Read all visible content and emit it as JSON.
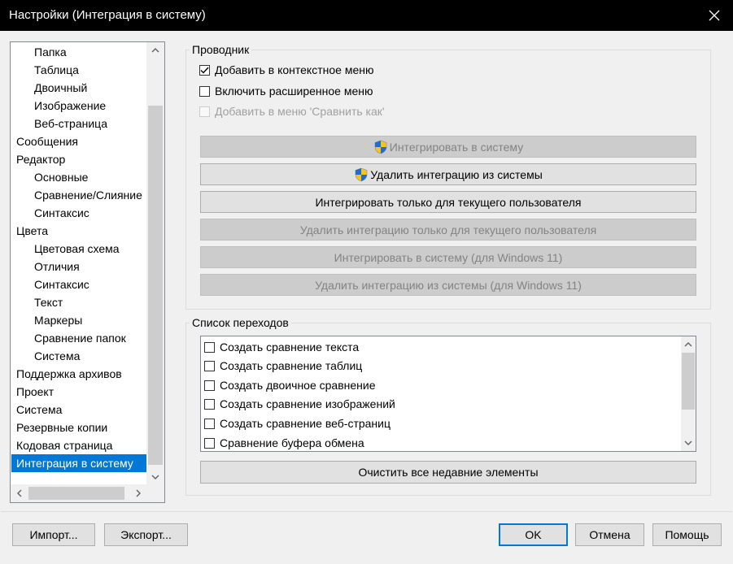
{
  "window": {
    "title": "Настройки (Интеграция в систему)"
  },
  "tree": {
    "items": [
      {
        "label": "Папка",
        "level": 1
      },
      {
        "label": "Таблица",
        "level": 1
      },
      {
        "label": "Двоичный",
        "level": 1
      },
      {
        "label": "Изображение",
        "level": 1
      },
      {
        "label": "Веб-страница",
        "level": 1
      },
      {
        "label": "Сообщения",
        "level": 0
      },
      {
        "label": "Редактор",
        "level": 0
      },
      {
        "label": "Основные",
        "level": 1
      },
      {
        "label": "Сравнение/Слияние",
        "level": 1
      },
      {
        "label": "Синтаксис",
        "level": 1
      },
      {
        "label": "Цвета",
        "level": 0
      },
      {
        "label": "Цветовая схема",
        "level": 1
      },
      {
        "label": "Отличия",
        "level": 1
      },
      {
        "label": "Синтаксис",
        "level": 1
      },
      {
        "label": "Текст",
        "level": 1
      },
      {
        "label": "Маркеры",
        "level": 1
      },
      {
        "label": "Сравнение папок",
        "level": 1
      },
      {
        "label": "Система",
        "level": 1
      },
      {
        "label": "Поддержка архивов",
        "level": 0
      },
      {
        "label": "Проект",
        "level": 0
      },
      {
        "label": "Система",
        "level": 0
      },
      {
        "label": "Резервные копии",
        "level": 0
      },
      {
        "label": "Кодовая страница",
        "level": 0
      },
      {
        "label": "Интеграция в систему",
        "level": 0,
        "selected": true
      }
    ]
  },
  "explorer": {
    "title": "Проводник",
    "options": [
      {
        "label": "Добавить в контекстное меню",
        "checked": true,
        "enabled": true
      },
      {
        "label": "Включить расширенное меню",
        "checked": false,
        "enabled": true
      },
      {
        "label": "Добавить в меню 'Сравнить как'",
        "checked": false,
        "enabled": false
      }
    ],
    "buttons": [
      {
        "label": "Интегрировать в систему",
        "enabled": false,
        "shield": true
      },
      {
        "label": "Удалить интеграцию из системы",
        "enabled": true,
        "shield": true
      },
      {
        "label": "Интегрировать только для текущего пользователя",
        "enabled": true,
        "shield": false
      },
      {
        "label": "Удалить интеграцию только для текущего пользователя",
        "enabled": false,
        "shield": false
      },
      {
        "label": "Интегрировать в систему (для Windows 11)",
        "enabled": false,
        "shield": false
      },
      {
        "label": "Удалить интеграцию из системы (для Windows 11)",
        "enabled": false,
        "shield": false
      }
    ]
  },
  "jumplist": {
    "title": "Список переходов",
    "items": [
      {
        "label": "Создать сравнение текста",
        "checked": false
      },
      {
        "label": "Создать сравнение таблиц",
        "checked": false
      },
      {
        "label": "Создать двоичное сравнение",
        "checked": false
      },
      {
        "label": "Создать сравнение изображений",
        "checked": false
      },
      {
        "label": "Создать сравнение веб-страниц",
        "checked": false
      },
      {
        "label": "Сравнение буфера обмена",
        "checked": false
      }
    ],
    "clear_button": "Очистить все недавние элементы"
  },
  "footer": {
    "import": "Импорт...",
    "export": "Экспорт...",
    "ok": "OK",
    "cancel": "Отмена",
    "help": "Помощь"
  },
  "colors": {
    "accent": "#0078d7",
    "titlebar": "#000000"
  }
}
